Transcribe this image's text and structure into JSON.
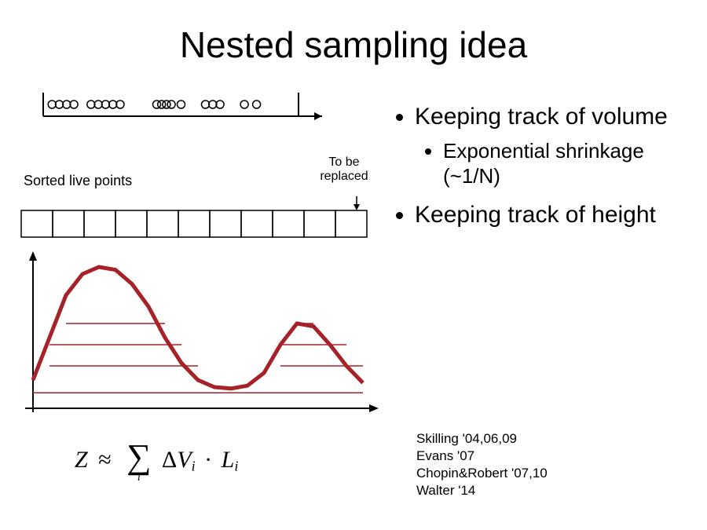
{
  "title": "Nested sampling idea",
  "labels": {
    "sorted": "Sorted live points",
    "to_replace_l1": "To be",
    "to_replace_l2": "replaced"
  },
  "bullets": {
    "b1": "Keeping track of volume",
    "b1a": "Exponential shrinkage (~1/N)",
    "b2": "Keeping track of height"
  },
  "formula": {
    "Z": "Z",
    "approx": "≈",
    "delta": "Δ",
    "V": "V",
    "i1": "i",
    "dot": "·",
    "L": "L",
    "i2": "i",
    "sum_index": "i"
  },
  "refs": {
    "r1": "Skilling '04,06,09",
    "r2": "Evans '07",
    "r3": "Chopin&Robert '07,10",
    "r4": "Walter '14"
  },
  "chart_data": {
    "type": "line",
    "title": "",
    "xlabel": "",
    "ylabel": "",
    "x": [
      0.0,
      0.05,
      0.1,
      0.15,
      0.2,
      0.25,
      0.3,
      0.35,
      0.4,
      0.45,
      0.5,
      0.55,
      0.6,
      0.65,
      0.7,
      0.75,
      0.8,
      0.85,
      0.9,
      0.95,
      1.0
    ],
    "values": [
      0.2,
      0.5,
      0.8,
      0.95,
      1.0,
      0.98,
      0.88,
      0.72,
      0.5,
      0.32,
      0.2,
      0.15,
      0.14,
      0.16,
      0.25,
      0.45,
      0.6,
      0.58,
      0.45,
      0.3,
      0.18
    ],
    "ylim": [
      0,
      1
    ],
    "hlines": [
      0.11,
      0.3,
      0.45,
      0.6
    ],
    "color": "#a52228"
  },
  "top_samples": [
    0.02,
    0.05,
    0.08,
    0.11,
    0.18,
    0.21,
    0.24,
    0.27,
    0.3,
    0.45,
    0.47,
    0.49,
    0.51,
    0.55,
    0.65,
    0.68,
    0.71,
    0.81,
    0.86
  ],
  "boxes_count": 11
}
